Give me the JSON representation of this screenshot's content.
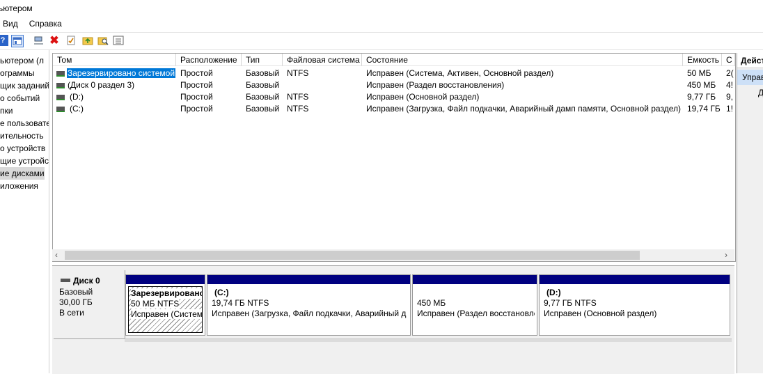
{
  "window": {
    "title": "ьютером"
  },
  "menu": {
    "items": [
      "Вид",
      "Справка"
    ]
  },
  "toolbar": {
    "icons": [
      "help-icon",
      "console-icon",
      "connect-icon",
      "delete-icon",
      "properties-icon",
      "folder-up-icon",
      "search-folder-icon",
      "list-view-icon"
    ]
  },
  "nav": {
    "items": [
      {
        "label": "ьютером (л"
      },
      {
        "label": "ограммы"
      },
      {
        "label": "щик заданий"
      },
      {
        "label": "о событий"
      },
      {
        "label": "пки"
      },
      {
        "label": "е пользовате"
      },
      {
        "label": "ительность"
      },
      {
        "label": "о устройств"
      },
      {
        "label": "щие устройст"
      },
      {
        "label": "ие дисками"
      },
      {
        "label": "иложения"
      }
    ]
  },
  "volume_list": {
    "columns": [
      "Том",
      "Расположение",
      "Тип",
      "Файловая система",
      "Состояние",
      "Емкость",
      "С"
    ],
    "rows": [
      {
        "name": "Зарезервировано системой",
        "layout": "Простой",
        "type": "Базовый",
        "fs": "NTFS",
        "status": "Исправен (Система, Активен, Основной раздел)",
        "capacity": "50 МБ",
        "free": "2("
      },
      {
        "name": "(Диск 0 раздел 3)",
        "layout": "Простой",
        "type": "Базовый",
        "fs": "",
        "status": "Исправен (Раздел восстановления)",
        "capacity": "450 МБ",
        "free": "4!"
      },
      {
        "name": "(D:)",
        "layout": "Простой",
        "type": "Базовый",
        "fs": "NTFS",
        "status": "Исправен (Основной раздел)",
        "capacity": "9,77 ГБ",
        "free": "9,"
      },
      {
        "name": "(C:)",
        "layout": "Простой",
        "type": "Базовый",
        "fs": "NTFS",
        "status": "Исправен (Загрузка, Файл подкачки, Аварийный дамп памяти, Основной раздел)",
        "capacity": "19,74 ГБ",
        "free": "1!"
      }
    ]
  },
  "disk": {
    "name": "Диск 0",
    "type": "Базовый",
    "size": "30,00 ГБ",
    "state": "В сети",
    "partitions": [
      {
        "title": "Зарезервированс",
        "size": "50 МБ NTFS",
        "status": "Исправен (Систем"
      },
      {
        "title": "(C:)",
        "size": "19,74 ГБ NTFS",
        "status": "Исправен (Загрузка, Файл подкачки, Аварийный д"
      },
      {
        "title": "",
        "size": "450 МБ",
        "status": "Исправен (Раздел восстановле"
      },
      {
        "title": "(D:)",
        "size": "9,77 ГБ NTFS",
        "status": "Исправен (Основной раздел)"
      }
    ]
  },
  "actions": {
    "header": "Дейст",
    "item": "Управ",
    "sub": "Д"
  }
}
